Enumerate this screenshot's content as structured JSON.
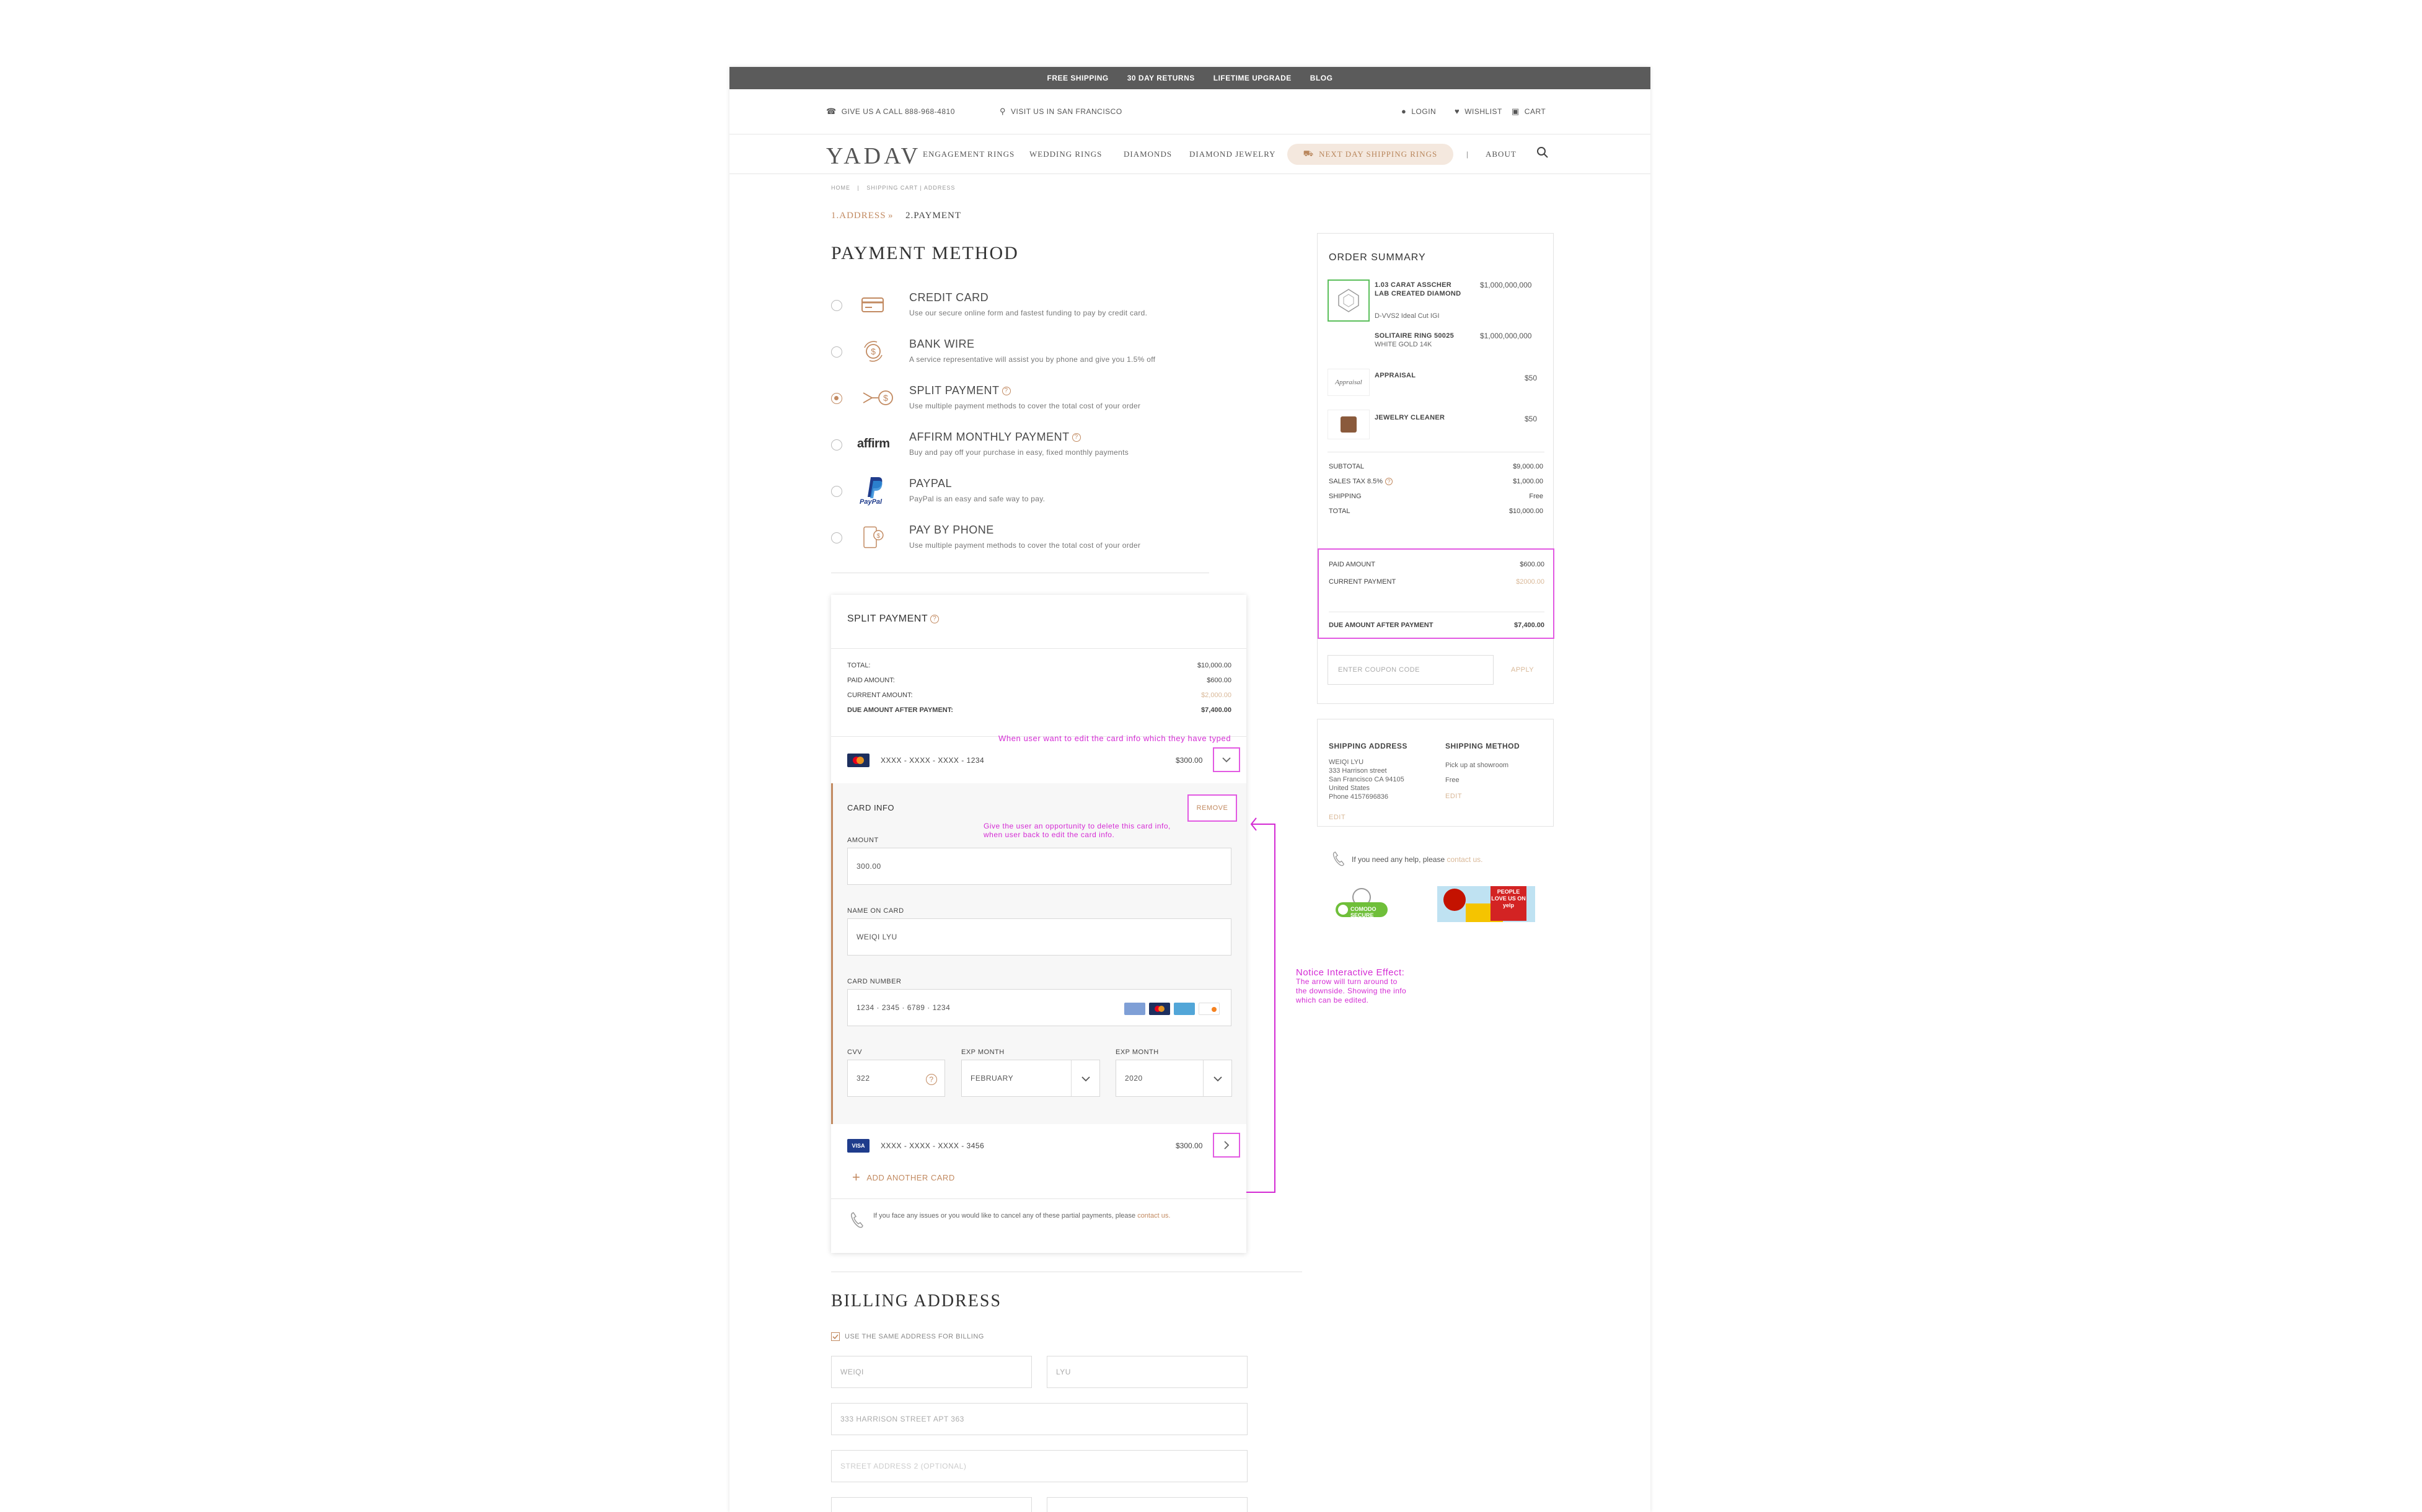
{
  "promo_bar": [
    "FREE SHIPPING",
    "30 DAY RETURNS",
    "LIFETIME UPGRADE",
    "BLOG"
  ],
  "utility": {
    "phone": "GIVE US A CALL 888-968-4810",
    "visit": "VISIT US IN SAN FRANCISCO",
    "login": "LOGIN",
    "wishlist": "WISHLIST",
    "cart": "CART"
  },
  "header": {
    "logo": "YADAV",
    "nav": [
      "ENGAGEMENT RINGS",
      "WEDDING RINGS",
      "DIAMONDS",
      "DIAMOND JEWELRY"
    ],
    "pill": "NEXT DAY SHIPPING RINGS",
    "separator": "|",
    "about": "ABOUT"
  },
  "breadcrumb": {
    "home": "HOME",
    "sep": "|",
    "current": "SHIPPING CART | ADDRESS"
  },
  "steps": {
    "step1": "1.ADDRESS",
    "arrow": "»",
    "step2": "2.PAYMENT"
  },
  "payment": {
    "title": "PAYMENT METHOD",
    "options": [
      {
        "title": "CREDIT CARD",
        "desc": "Use our secure online form and fastest funding to pay by credit card.",
        "icon": "credit-card-icon"
      },
      {
        "title": "BANK WIRE",
        "desc": "A service representative will assist you by phone and give you 1.5% off",
        "icon": "bank-wire-icon"
      },
      {
        "title": "SPLIT PAYMENT",
        "desc": "Use multiple payment methods to cover the total cost of your order",
        "icon": "split-payment-icon",
        "selected": true
      },
      {
        "title": "AFFIRM MONTHLY PAYMENT",
        "desc": "Buy and pay off your purchase in easy, fixed monthly payments",
        "icon": "affirm-icon",
        "logo": "affirm"
      },
      {
        "title": "PAYPAL",
        "desc": "PayPal is an easy and safe way to pay.",
        "icon": "paypal-icon",
        "logo": "PayPal"
      },
      {
        "title": "PAY BY PHONE",
        "desc": "Use multiple payment methods to cover the total cost of your order",
        "icon": "phone-payment-icon"
      }
    ]
  },
  "split": {
    "title": "SPLIT PAYMENT",
    "rows": [
      {
        "label": "TOTAL:",
        "value": "$10,000.00"
      },
      {
        "label": "PAID AMOUNT:",
        "value": "$600.00"
      },
      {
        "label": "CURRENT AMOUNT:",
        "value": "$2,000.00"
      },
      {
        "label": "DUE AMOUNT AFTER PAYMENT:",
        "value": "$7,400.00"
      }
    ],
    "card1": {
      "number": "XXXX - XXXX - XXXX - 1234",
      "amount": "$300.00",
      "brand": "mastercard"
    },
    "card_info": {
      "title": "CARD INFO",
      "remove": "REMOVE",
      "amount_label": "AMOUNT",
      "amount_value": "300.00",
      "name_label": "NAME ON CARD",
      "name_value": "WEIQI LYU",
      "number_label": "CARD NUMBER",
      "number_value": "1234 · 2345 · 6789 · 1234",
      "cvv_label": "CVV",
      "cvv_value": "322",
      "month_label": "EXP MONTH",
      "month_value": "FEBRUARY",
      "year_label": "EXP MONTH",
      "year_value": "2020"
    },
    "card2": {
      "number": "XXXX - XXXX - XXXX - 3456",
      "amount": "$300.00",
      "brand": "VISA"
    },
    "add_card": "ADD ANOTHER CARD",
    "help_text": "If you face any issues or you would like to cancel any of these partial payments, please",
    "help_link": "contact us."
  },
  "billing": {
    "title": "BILLING ADDRESS",
    "same_address": "USE THE SAME ADDRESS FOR BILLING",
    "first": "WEIQI",
    "last": "LYU",
    "street": "333 HARRISON STREET APT 363",
    "street2": "STREET ADDRESS 2 (OPTIONAL)"
  },
  "annotations": {
    "edit_card": "When user want to edit the card info which they have typed",
    "delete_card_1": "Give the user an opportunity to delete this card info,",
    "delete_card_2": "when user back to edit the card info.",
    "notice_title": "Notice Interactive Effect:",
    "notice_body": [
      "The arrow will turn around to",
      "the downside. Showing the info",
      "which can be edited."
    ]
  },
  "order_summary": {
    "title": "ORDER SUMMARY",
    "items": [
      {
        "name": "1.03 CARAT ASSCHER LAB CREATED DIAMOND",
        "sub": "D-VVS2 Ideal Cut IGI",
        "price": "$1,000,000,000"
      },
      {
        "name": "SOLITAIRE RING 50025",
        "sub": "WHITE GOLD 14K",
        "price": "$1,000,000,000"
      },
      {
        "name": "APPRAISAL",
        "sub": "",
        "price": "$50"
      },
      {
        "name": "JEWELRY CLEANER",
        "sub": "",
        "price": "$50"
      }
    ],
    "appraisal_script": "Appraisal",
    "totals": [
      {
        "label": "SUBTOTAL",
        "value": "$9,000.00"
      },
      {
        "label": "SALES TAX 8.5%",
        "value": "$1,000.00"
      },
      {
        "label": "SHIPPING",
        "value": "Free"
      },
      {
        "label": "TOTAL",
        "value": "$10,000.00"
      }
    ],
    "paid": [
      {
        "label": "PAID AMOUNT",
        "value": "$600.00"
      },
      {
        "label": "CURRENT PAYMENT",
        "value": "$2000.00"
      }
    ],
    "due": {
      "label": "DUE AMOUNT AFTER PAYMENT",
      "value": "$7,400.00"
    },
    "coupon_placeholder": "ENTER COUPON CODE",
    "apply": "APPLY"
  },
  "shipping": {
    "address_title": "SHIPPING ADDRESS",
    "address_lines": [
      "WEIQI LYU",
      "333 Harrison street",
      "San Francisco CA 94105",
      "United States",
      "Phone 4157696836"
    ],
    "edit": "EDIT",
    "method_title": "SHIPPING METHOD",
    "method_lines": [
      "Pick up at showroom",
      "Free"
    ],
    "method_edit": "EDIT"
  },
  "help": {
    "text": "If you need any help, please",
    "link": "contact us."
  },
  "badges": {
    "comodo": "COMODO SECURE",
    "yelp": "PEOPLE LOVE US ON yelp"
  },
  "colors": {
    "accent": "#c28a61",
    "annotation": "#d42bd4",
    "promo_bg": "#5b5b5b"
  }
}
